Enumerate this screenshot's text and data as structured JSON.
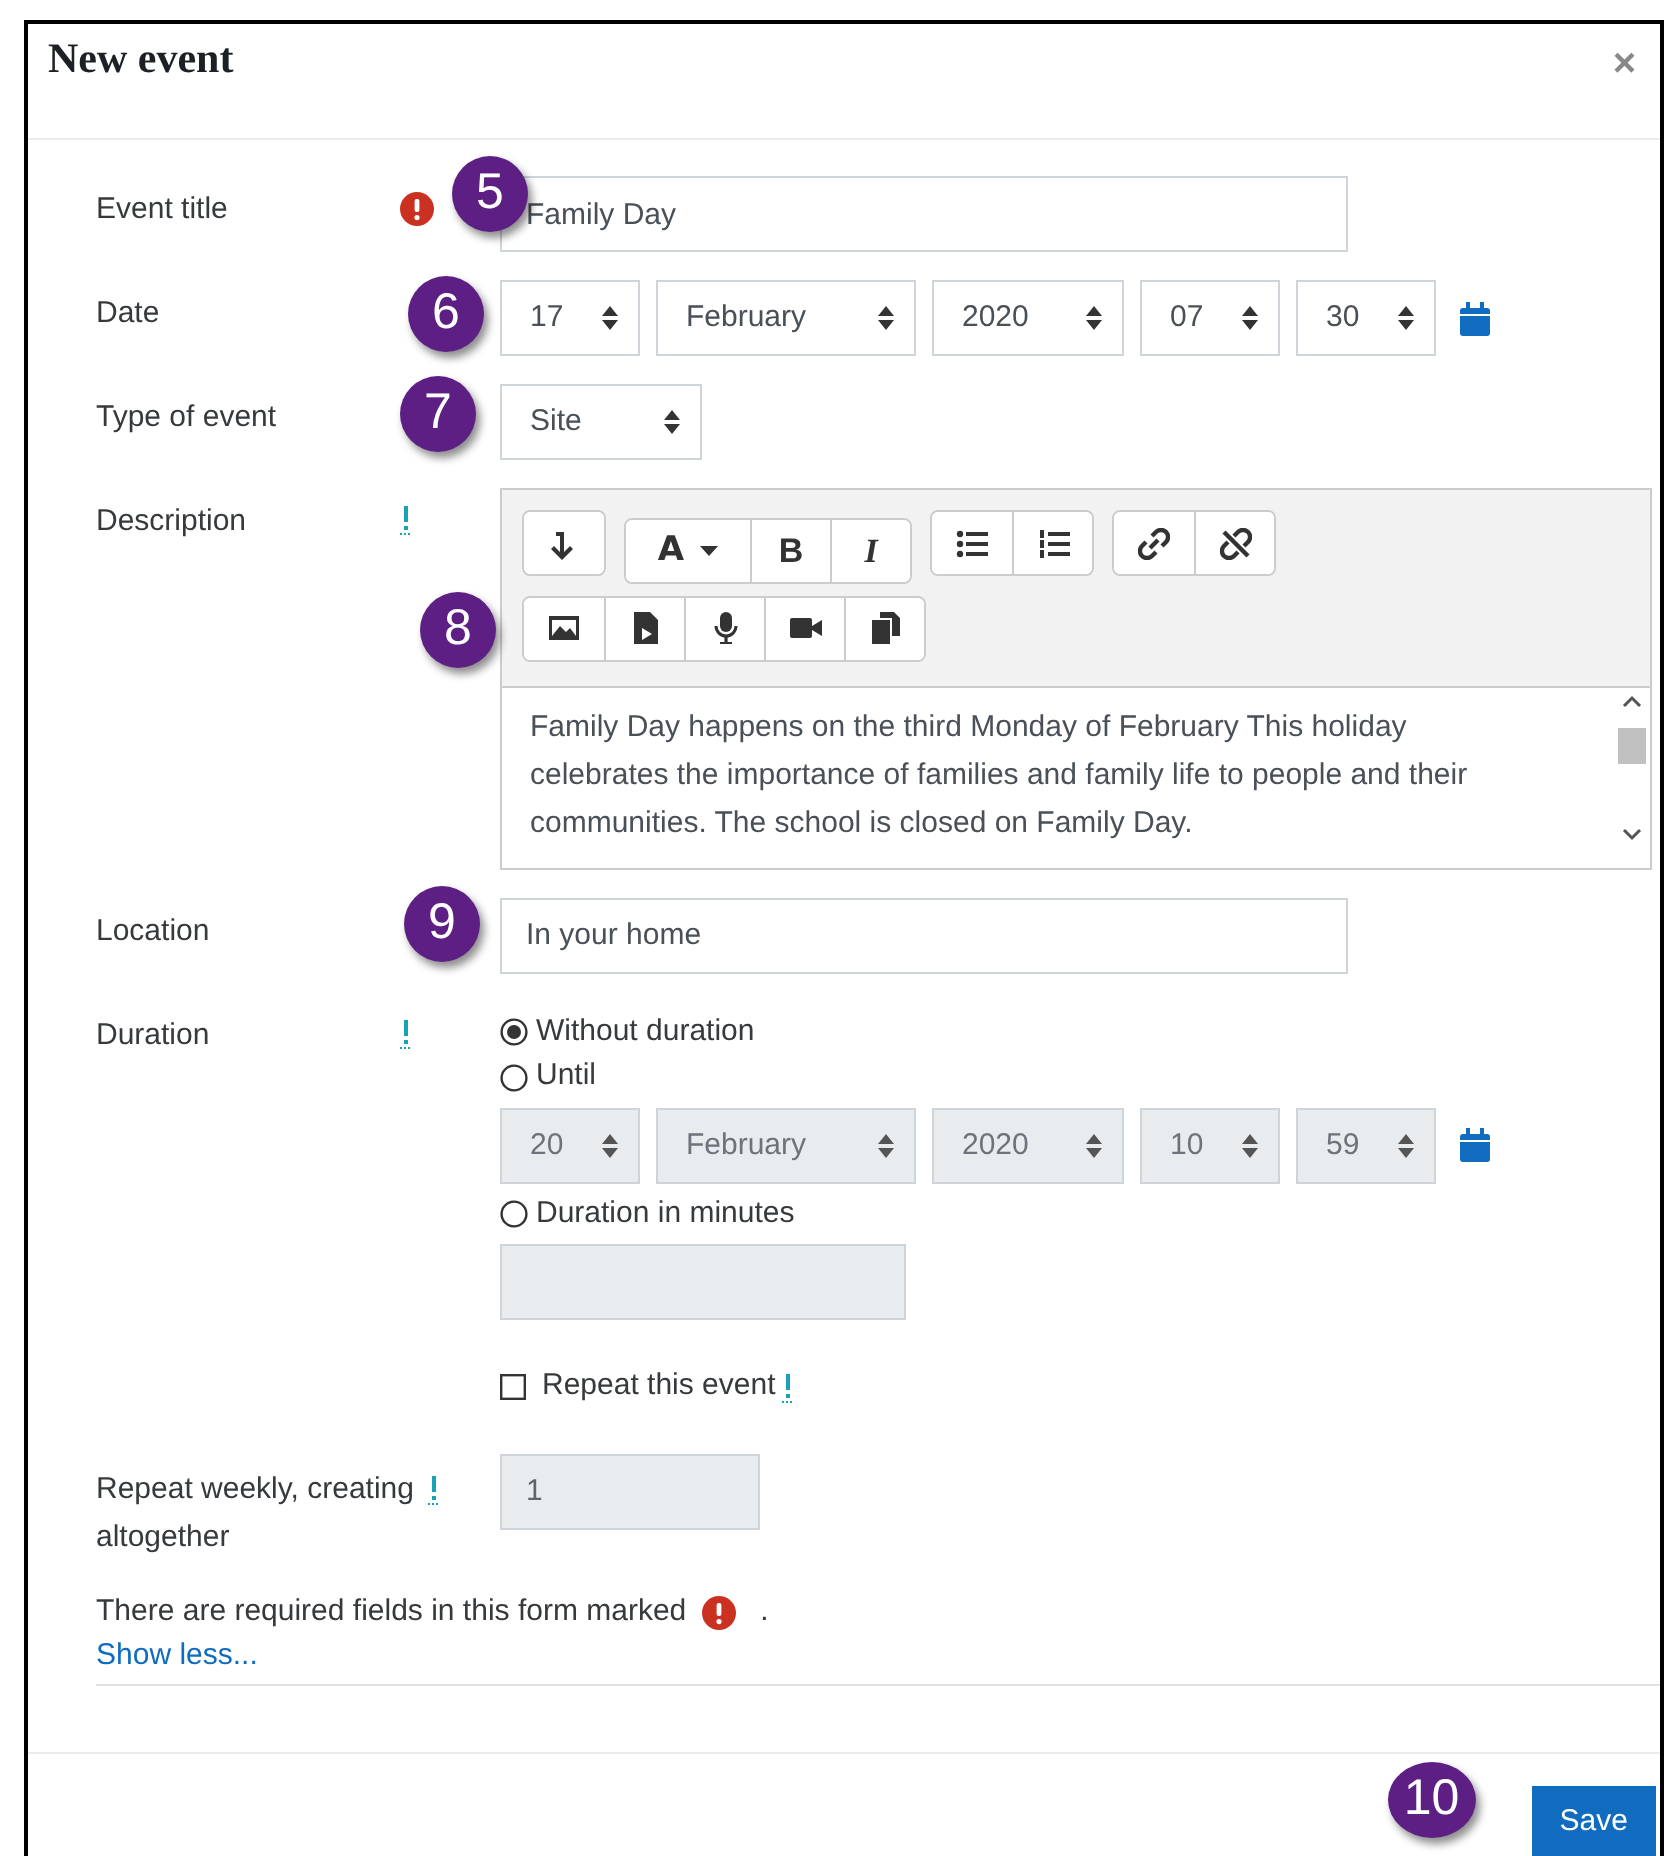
{
  "window": {
    "title": "New event",
    "close": "×"
  },
  "event_title": {
    "label": "Event title",
    "required": true,
    "value": "Family Day",
    "callout": "5"
  },
  "date": {
    "label": "Date",
    "callout": "6",
    "parts": [
      {
        "value": "17",
        "kind": "day"
      },
      {
        "value": "February",
        "kind": "month"
      },
      {
        "value": "2020",
        "kind": "year"
      },
      {
        "value": "07",
        "kind": "hour"
      },
      {
        "value": "30",
        "kind": "minute"
      }
    ]
  },
  "type_of_event": {
    "label": "Type of event",
    "value": "Site",
    "callout": "7"
  },
  "description": {
    "label": "Description",
    "help": true,
    "callout": "8",
    "toolbar": [
      [
        [
          {
            "kind": "collapse"
          }
        ],
        [
          {
            "kind": "font",
            "label": "A"
          },
          {
            "kind": "bold",
            "label": "B"
          },
          {
            "kind": "italic",
            "label": "I"
          }
        ],
        [
          {
            "kind": "bullets"
          },
          {
            "kind": "numbers"
          }
        ],
        [
          {
            "kind": "link"
          },
          {
            "kind": "unlink"
          }
        ]
      ],
      [
        [
          {
            "kind": "image"
          },
          {
            "kind": "media"
          },
          {
            "kind": "mic"
          },
          {
            "kind": "video"
          },
          {
            "kind": "copy"
          }
        ]
      ]
    ],
    "text": "Family Day happens on the third Monday of February This holiday celebrates the importance of families and family life to people and their communities. The school is closed on Family Day."
  },
  "location": {
    "label": "Location",
    "value": "In your home",
    "callout": "9"
  },
  "duration": {
    "label": "Duration",
    "help": true,
    "options": [
      {
        "label": "Without duration",
        "selected": true
      },
      {
        "label": "Until",
        "selected": false
      },
      {
        "label": "Duration in minutes",
        "selected": false
      }
    ],
    "until_disabled": true,
    "until_parts": [
      {
        "value": "20",
        "kind": "day"
      },
      {
        "value": "February",
        "kind": "month"
      },
      {
        "value": "2020",
        "kind": "year"
      },
      {
        "value": "10",
        "kind": "hour"
      },
      {
        "value": "59",
        "kind": "minute"
      }
    ],
    "minutes_disabled": true
  },
  "repeat": {
    "label": "Repeat this event",
    "checked": false,
    "help": true
  },
  "repeat_weekly": {
    "label": "Repeat weekly, creating altogether",
    "help": true,
    "value": "1",
    "disabled": true
  },
  "required_note": {
    "text": "There are required fields in this form marked",
    "after": "."
  },
  "show_less": "Show less...",
  "footer": {
    "save": "Save",
    "callout": "10"
  }
}
